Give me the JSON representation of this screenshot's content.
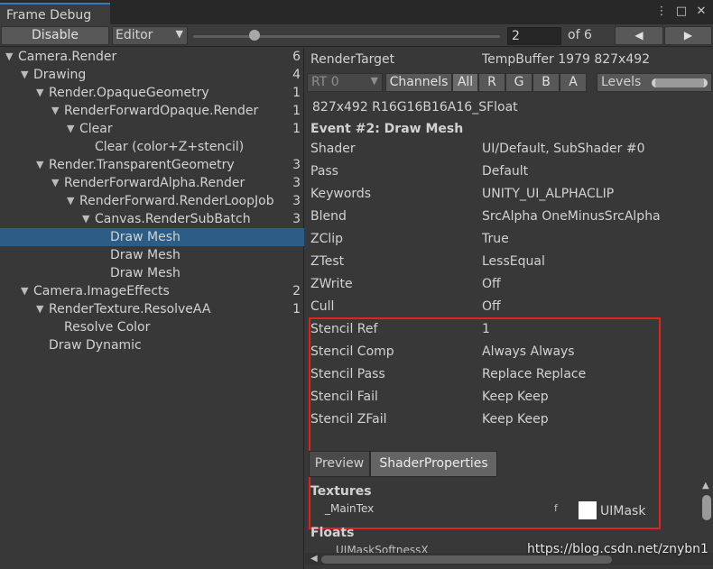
{
  "window": {
    "tab_title": "Frame Debug",
    "menu_icon": "⋮",
    "maximize_icon": "□",
    "close_icon": "✕"
  },
  "toolbar": {
    "disable_label": "Disable",
    "target_dropdown": "Editor",
    "step_value": "2",
    "step_total": "of 6",
    "slider_fraction": 0.2,
    "prev_icon": "◀",
    "next_icon": "▶"
  },
  "tree": [
    {
      "label": "Camera.Render",
      "count": "6",
      "expanded": true
    },
    {
      "label": "Drawing",
      "count": "4",
      "expanded": true
    },
    {
      "label": "Render.OpaqueGeometry",
      "count": "1",
      "expanded": true
    },
    {
      "label": "RenderForwardOpaque.Render",
      "count": "1",
      "expanded": true
    },
    {
      "label": "Clear",
      "count": "1",
      "expanded": true
    },
    {
      "label": "Clear (color+Z+stencil)",
      "count": "",
      "expanded": null
    },
    {
      "label": "Render.TransparentGeometry",
      "count": "3",
      "expanded": true
    },
    {
      "label": "RenderForwardAlpha.Render",
      "count": "3",
      "expanded": true
    },
    {
      "label": "RenderForward.RenderLoopJob",
      "count": "3",
      "expanded": true
    },
    {
      "label": "Canvas.RenderSubBatch",
      "count": "3",
      "expanded": true
    },
    {
      "label": "Draw Mesh",
      "count": "",
      "expanded": null,
      "selected": true
    },
    {
      "label": "Draw Mesh",
      "count": "",
      "expanded": null
    },
    {
      "label": "Draw Mesh",
      "count": "",
      "expanded": null
    },
    {
      "label": "Camera.ImageEffects",
      "count": "2",
      "expanded": true
    },
    {
      "label": "RenderTexture.ResolveAA",
      "count": "1",
      "expanded": true
    },
    {
      "label": "Resolve Color",
      "count": "",
      "expanded": null
    },
    {
      "label": "Draw Dynamic",
      "count": "",
      "expanded": null
    }
  ],
  "details": {
    "render_target_label": "RenderTarget",
    "render_target_value": "TempBuffer 1979 827x492",
    "rt_dropdown": "RT 0",
    "channels_label": "Channels",
    "channel_buttons": [
      "All",
      "R",
      "G",
      "B",
      "A"
    ],
    "levels_label": "Levels",
    "format_line": "827x492 R16G16B16A16_SFloat",
    "event_title": "Event #2: Draw Mesh",
    "properties": [
      {
        "key": "Shader",
        "value": "UI/Default, SubShader #0"
      },
      {
        "key": "Pass",
        "value": "Default"
      },
      {
        "key": "Keywords",
        "value": "UNITY_UI_ALPHACLIP"
      },
      {
        "key": "Blend",
        "value": "SrcAlpha OneMinusSrcAlpha"
      },
      {
        "key": "ZClip",
        "value": "True"
      },
      {
        "key": "ZTest",
        "value": "LessEqual"
      },
      {
        "key": "ZWrite",
        "value": "Off"
      },
      {
        "key": "Cull",
        "value": "Off"
      },
      {
        "key": "Stencil Ref",
        "value": "1"
      },
      {
        "key": "Stencil Comp",
        "value": "Always Always"
      },
      {
        "key": "Stencil Pass",
        "value": "Replace Replace"
      },
      {
        "key": "Stencil Fail",
        "value": "Keep Keep"
      },
      {
        "key": "Stencil ZFail",
        "value": "Keep Keep"
      }
    ],
    "tabs": {
      "preview": "Preview",
      "shader_properties": "ShaderProperties"
    },
    "textures_heading": "Textures",
    "main_tex_name": "_MainTex",
    "main_tex_stage": "f",
    "main_tex_value": "UIMask",
    "floats_heading": "Floats",
    "float_partial": "_UIMaskSoftnessX"
  },
  "watermark": "https://blog.csdn.net/znybn1",
  "colors": {
    "selection": "#2c5d87",
    "highlight_box": "#e0231f",
    "tab_accent": "#3a79bb"
  }
}
